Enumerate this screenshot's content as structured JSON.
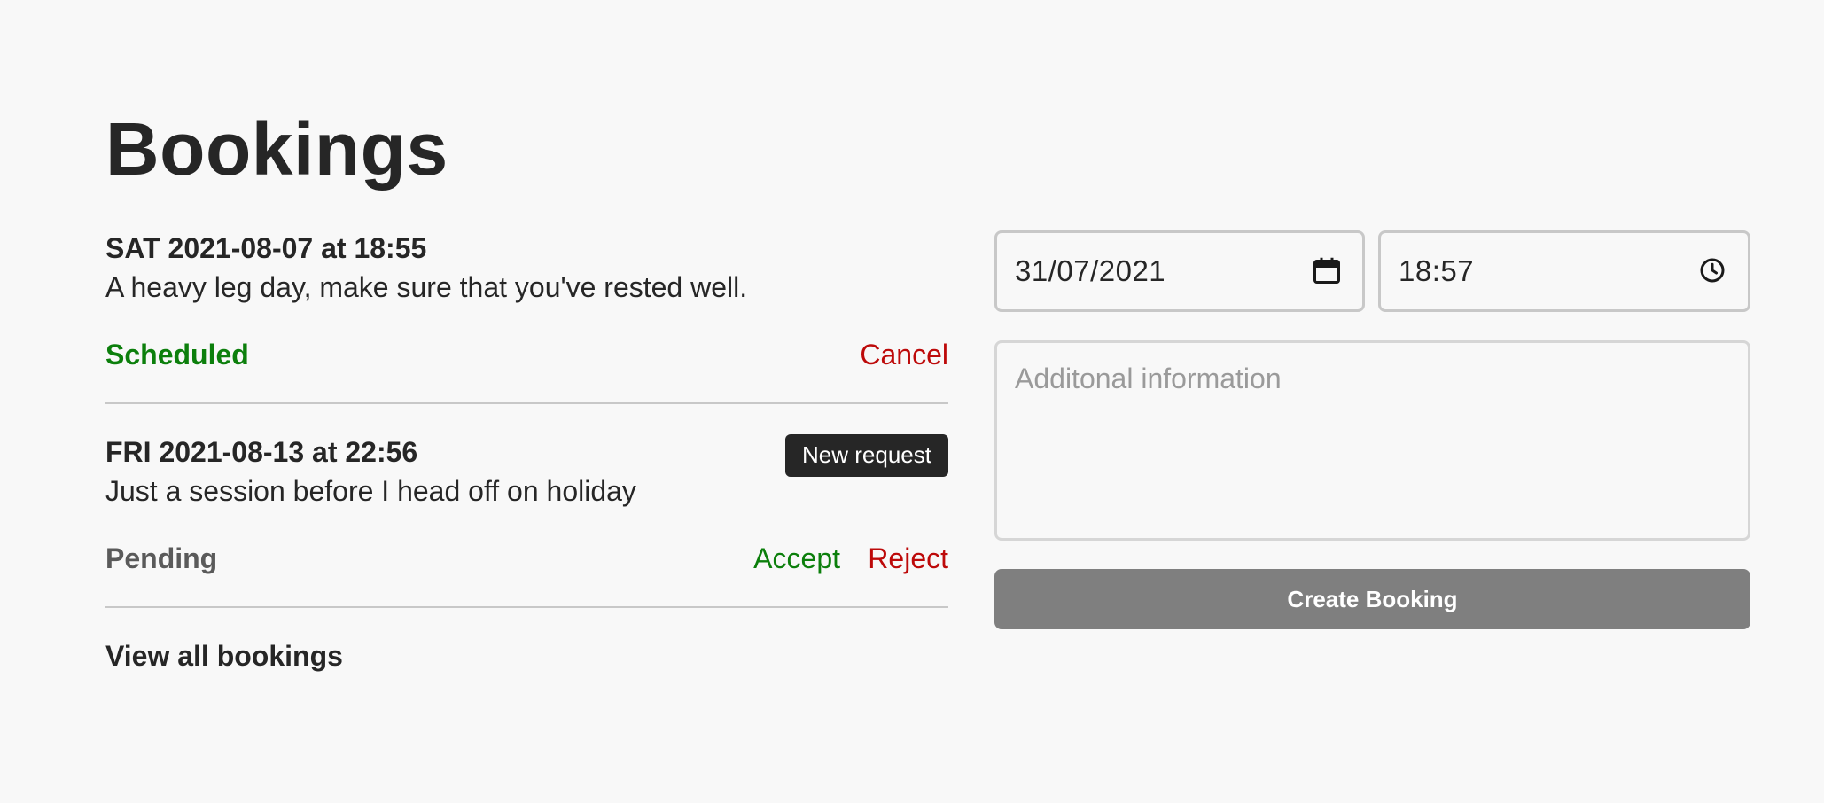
{
  "page": {
    "title": "Bookings"
  },
  "bookings": [
    {
      "when": "SAT 2021-08-07 at 18:55",
      "description": "A heavy leg day, make sure that you've rested well.",
      "status": "Scheduled",
      "actions": [
        "Cancel"
      ]
    },
    {
      "when": "FRI 2021-08-13 at 22:56",
      "description": "Just a session before I head off on holiday",
      "badge": "New request",
      "status": "Pending",
      "actions": [
        "Accept",
        "Reject"
      ]
    }
  ],
  "view_all_label": "View all bookings",
  "form": {
    "date_value": "31/07/2021",
    "time_value": "18:57",
    "info_placeholder": "Additonal information",
    "submit_label": "Create Booking"
  },
  "colors": {
    "scheduled": "#0c7f0c",
    "pending": "#5a5a5a",
    "accept": "#0c7f0c",
    "reject_cancel": "#bd0a0a",
    "button_bg": "#7f7f7f",
    "badge_bg": "#262626"
  },
  "icons": {
    "date": "calendar-icon",
    "time": "clock-icon"
  }
}
